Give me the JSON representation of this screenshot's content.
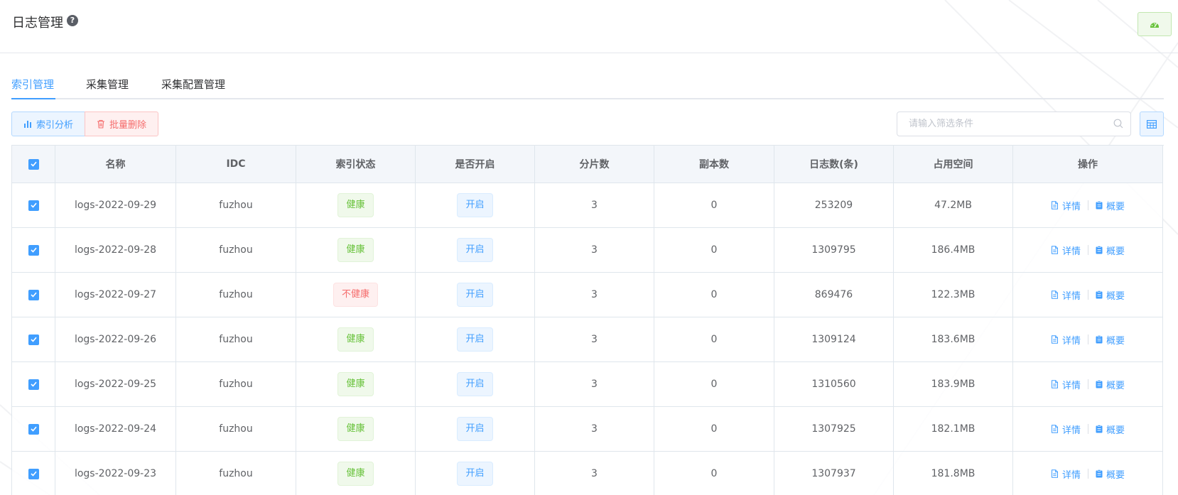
{
  "header": {
    "title": "日志管理",
    "help_glyph": "?"
  },
  "tabs": [
    {
      "label": "索引管理",
      "active": true
    },
    {
      "label": "采集管理",
      "active": false
    },
    {
      "label": "采集配置管理",
      "active": false
    }
  ],
  "toolbar": {
    "analyze_label": "索引分析",
    "delete_label": "批量删除",
    "search_placeholder": "请输入筛选条件"
  },
  "table": {
    "columns": [
      "名称",
      "IDC",
      "索引状态",
      "是否开启",
      "分片数",
      "副本数",
      "日志数(条)",
      "占用空间",
      "操作"
    ],
    "detail_label": "详情",
    "overview_label": "概要",
    "rows": [
      {
        "name": "logs-2022-09-29",
        "idc": "fuzhou",
        "status": "健康",
        "healthy": true,
        "enabled": "开启",
        "shards": "3",
        "replicas": "0",
        "logs": "253209",
        "size": "47.2MB"
      },
      {
        "name": "logs-2022-09-28",
        "idc": "fuzhou",
        "status": "健康",
        "healthy": true,
        "enabled": "开启",
        "shards": "3",
        "replicas": "0",
        "logs": "1309795",
        "size": "186.4MB"
      },
      {
        "name": "logs-2022-09-27",
        "idc": "fuzhou",
        "status": "不健康",
        "healthy": false,
        "enabled": "开启",
        "shards": "3",
        "replicas": "0",
        "logs": "869476",
        "size": "122.3MB"
      },
      {
        "name": "logs-2022-09-26",
        "idc": "fuzhou",
        "status": "健康",
        "healthy": true,
        "enabled": "开启",
        "shards": "3",
        "replicas": "0",
        "logs": "1309124",
        "size": "183.6MB"
      },
      {
        "name": "logs-2022-09-25",
        "idc": "fuzhou",
        "status": "健康",
        "healthy": true,
        "enabled": "开启",
        "shards": "3",
        "replicas": "0",
        "logs": "1310560",
        "size": "183.9MB"
      },
      {
        "name": "logs-2022-09-24",
        "idc": "fuzhou",
        "status": "健康",
        "healthy": true,
        "enabled": "开启",
        "shards": "3",
        "replicas": "0",
        "logs": "1307925",
        "size": "182.1MB"
      },
      {
        "name": "logs-2022-09-23",
        "idc": "fuzhou",
        "status": "健康",
        "healthy": true,
        "enabled": "开启",
        "shards": "3",
        "replicas": "0",
        "logs": "1307937",
        "size": "181.8MB"
      }
    ]
  },
  "colors": {
    "primary": "#409eff",
    "success": "#67c23a",
    "danger": "#f56c6c"
  },
  "icons": [
    "help-icon",
    "dashboard-icon",
    "bar-chart-icon",
    "trash-icon",
    "search-icon",
    "table-columns-icon",
    "checkbox-check-icon",
    "document-icon",
    "clipboard-icon"
  ]
}
